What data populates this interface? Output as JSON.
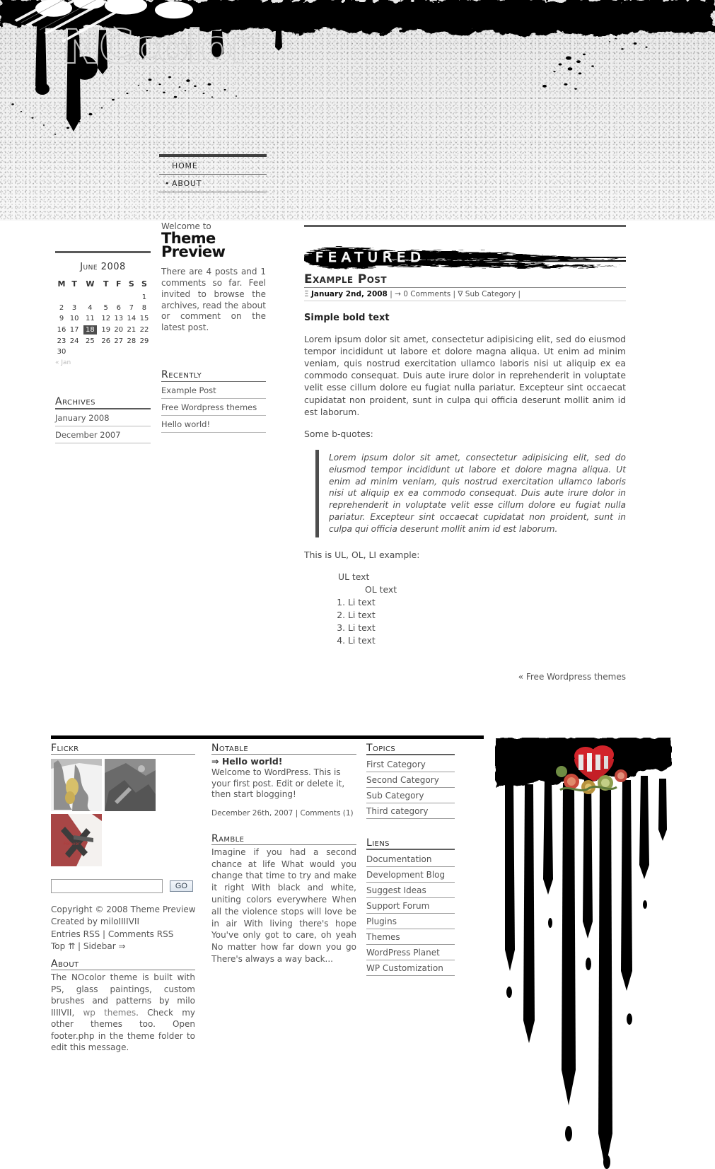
{
  "site": {
    "logo_text": "NCcolor",
    "nav": [
      {
        "label": "HOME",
        "bullet": false
      },
      {
        "label": "ABOUT",
        "bullet": true
      }
    ]
  },
  "sidebar_calendar": {
    "title": "June 2008",
    "weekdays": [
      "M",
      "T",
      "W",
      "T",
      "F",
      "S",
      "S"
    ],
    "weeks": [
      [
        "",
        "",
        "",
        "",
        "",
        "",
        "1"
      ],
      [
        "2",
        "3",
        "4",
        "5",
        "6",
        "7",
        "8"
      ],
      [
        "9",
        "10",
        "11",
        "12",
        "13",
        "14",
        "15"
      ],
      [
        "16",
        "17",
        "18",
        "19",
        "20",
        "21",
        "22"
      ],
      [
        "23",
        "24",
        "25",
        "26",
        "27",
        "28",
        "29"
      ],
      [
        "30",
        "",
        "",
        "",
        "",
        "",
        ""
      ]
    ],
    "today": "18",
    "prev_link": "« Jan"
  },
  "archives": {
    "heading": "Archives",
    "items": [
      "January 2008",
      "December 2007"
    ]
  },
  "welcome": {
    "pre": "Welcome to",
    "title_line1": "Theme",
    "title_line2": "Preview",
    "body": "There are 4 posts and 1 comments so far. Feel invited to browse the archives, read the about or comment on the latest post."
  },
  "recently": {
    "heading": "Recently",
    "items": [
      "Example Post",
      "Free Wordpress themes",
      "Hello world!"
    ]
  },
  "featured": {
    "banner_label": "FEATURED",
    "post_title": "Example Post",
    "meta_date": "January 2nd, 2008",
    "meta_comments": "0 Comments",
    "meta_category": "Sub Category",
    "meta_date_icon": "calendar-icon",
    "meta_comments_icon": "arrow-right-icon",
    "meta_category_icon": "folder-icon"
  },
  "post": {
    "bold_heading": "Simple bold text",
    "paragraph1": "Lorem ipsum dolor sit amet, consectetur adipisicing elit, sed do eiusmod tempor incididunt ut labore et dolore magna aliqua. Ut enim ad minim veniam, quis nostrud exercitation ullamco laboris nisi ut aliquip ex ea commodo consequat. Duis aute irure dolor in reprehenderit in voluptate velit esse cillum dolore eu fugiat nulla pariatur. Excepteur sint occaecat cupidatat non proident, sunt in culpa qui officia deserunt mollit anim id est laborum.",
    "quote_intro": "Some b-quotes:",
    "blockquote": "Lorem ipsum dolor sit amet, consectetur adipisicing elit, sed do eiusmod tempor incididunt ut labore et dolore magna aliqua. Ut enim ad minim veniam, quis nostrud exercitation ullamco laboris nisi ut aliquip ex ea commodo consequat. Duis aute irure dolor in reprehenderit in voluptate velit esse cillum dolore eu fugiat nulla pariatur. Excepteur sint occaecat cupidatat non proident, sunt in culpa qui officia deserunt mollit anim id est laborum.",
    "list_intro": "This is UL, OL, LI example:",
    "ul_text": "UL text",
    "ol_text": "OL text",
    "li_items": [
      "Li text",
      "Li text",
      "Li text",
      "Li text"
    ]
  },
  "post_nav": {
    "prev_label": "« Free Wordpress themes"
  },
  "footer": {
    "flickr": {
      "heading": "Flickr"
    },
    "search": {
      "value": "",
      "placeholder": "",
      "button_label": "GO"
    },
    "copyright": {
      "line1": "Copyright © 2008 Theme Preview",
      "line2": "Created by miloIIIIVII",
      "entries_rss": "Entries RSS",
      "comments_rss": "Comments RSS",
      "separator": "|",
      "top": "Top ⇈",
      "sidebar": "Sidebar ⇒"
    },
    "about": {
      "heading": "About",
      "text_part1": "The NOcolor theme is built with PS, glass paintings, custom brushes and patterns by milo IIIIVII,",
      "link_text": "wp themes",
      "text_part2": ". Check my other themes too. Open footer.php in the theme folder to edit this message."
    },
    "notable": {
      "heading": "Notable",
      "post_title": "⇒ Hello world!",
      "excerpt": "Welcome to WordPress. This is your first post. Edit or delete it, then start blogging!",
      "date": "December 26th, 2007 | Comments (1)"
    },
    "ramble": {
      "heading": "Ramble",
      "text": "Imagine if you had a second chance at life What would you change that time to try and make it right With black and white, uniting colors everywhere When all the violence stops will love be in air With living there's hope You've only got to care, oh yeah No matter how far down you go There's always a way back..."
    },
    "topics": {
      "heading": "Topics",
      "items": [
        "First Category",
        "Second Category",
        "Sub Category",
        "Third category"
      ]
    },
    "liens": {
      "heading": "Liens",
      "items": [
        "Documentation",
        "Development Blog",
        "Suggest Ideas",
        "Support Forum",
        "Plugins",
        "Themes",
        "WordPress Planet",
        "WP Customization"
      ]
    }
  },
  "colors": {
    "ink": "#000000",
    "text": "#555555",
    "rule": "#5a5a5a",
    "accent_red": "#a84646",
    "heart_red": "#d2232a"
  }
}
